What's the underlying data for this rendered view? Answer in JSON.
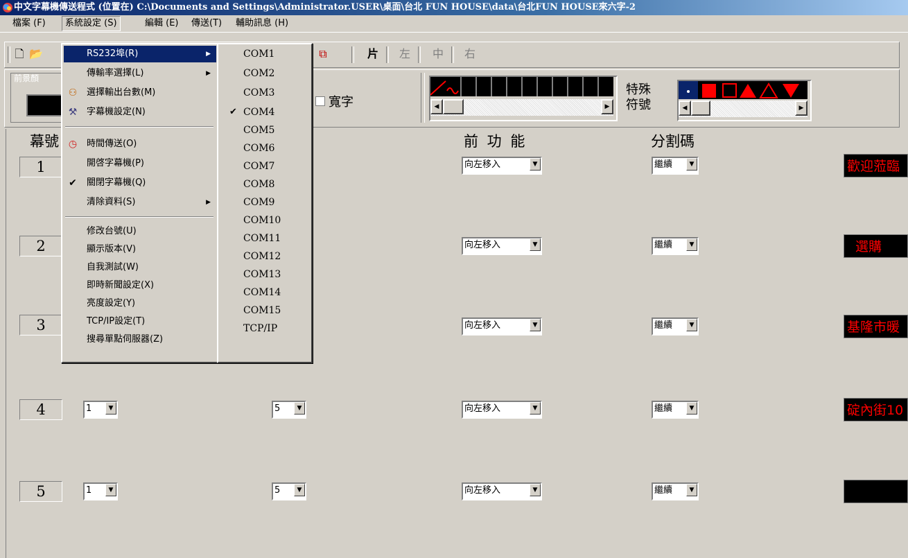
{
  "window": {
    "title": "中文字幕機傳送程式 (位置在) C:\\Documents and Settings\\Administrator.USER\\桌面\\台北 FUN HOUSE\\data\\台北FUN HOUSE來六字-2"
  },
  "menubar": {
    "items": [
      "檔案 (F)",
      "系統設定 (S)",
      "編輯 (E)",
      "傳送(T)",
      "輔助訊息 (H)"
    ]
  },
  "toolbar": {
    "align_labels": [
      "片",
      "左",
      "中",
      "右"
    ]
  },
  "options": {
    "group_label": "前景顏",
    "wide_char_label": "寬字",
    "special_symbol_label": "特殊\n符號"
  },
  "table": {
    "headers": [
      "幕號",
      "前 功 能",
      "分割碼"
    ],
    "rows": [
      {
        "num": "1",
        "a": "",
        "b": "",
        "effect": "向左移入",
        "split": "繼續",
        "text": "歡迎蒞臨"
      },
      {
        "num": "2",
        "a": "",
        "b": "",
        "effect": "向左移入",
        "split": "繼續",
        "text": "選購"
      },
      {
        "num": "3",
        "a": "",
        "b": "",
        "effect": "向左移入",
        "split": "繼續",
        "text": "基隆市暖"
      },
      {
        "num": "4",
        "a": "1",
        "b": "5",
        "effect": "向左移入",
        "split": "繼續",
        "text": "碇內街10"
      },
      {
        "num": "5",
        "a": "1",
        "b": "5",
        "effect": "向左移入",
        "split": "繼續",
        "text": ""
      }
    ]
  },
  "system_menu": {
    "items": [
      {
        "label": "RS232埠(R)",
        "submenu": true,
        "selected": true
      },
      {
        "label": "傳輸率選擇(L)",
        "submenu": true
      },
      {
        "label": "選擇輸出台數(M)",
        "icon": "people-icon"
      },
      {
        "label": "字幕機設定(N)",
        "icon": "tools-icon"
      },
      {
        "label": "時間傳送(O)",
        "icon": "clock-icon"
      },
      {
        "label": "開啓字幕機(P)"
      },
      {
        "label": "關閉字幕機(Q)",
        "checked": true
      },
      {
        "label": "清除資料(S)",
        "submenu": true
      },
      {
        "label": "修改台號(U)"
      },
      {
        "label": "顯示版本(V)"
      },
      {
        "label": "自我測試(W)"
      },
      {
        "label": "即時新聞設定(X)"
      },
      {
        "label": "亮度設定(Y)"
      },
      {
        "label": "TCP/IP設定(T)"
      },
      {
        "label": "搜尋單點伺服器(Z)"
      }
    ]
  },
  "port_menu": {
    "items": [
      "COM1",
      "COM2",
      "COM3",
      "COM4",
      "COM5",
      "COM6",
      "COM7",
      "COM8",
      "COM9",
      "COM10",
      "COM11",
      "COM12",
      "COM13",
      "COM14",
      "COM15",
      "TCP/IP"
    ],
    "checked": "COM4"
  },
  "colors": {
    "menu_highlight": "#0a246a",
    "led_text": "#ff0000"
  }
}
